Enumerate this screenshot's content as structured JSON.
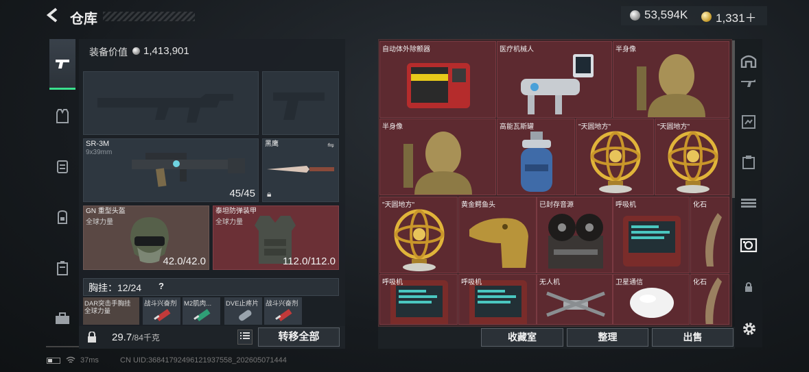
{
  "header": {
    "back_label": "<",
    "title": "仓库",
    "currency": [
      {
        "name": "silver",
        "value": "53,594K"
      },
      {
        "name": "gold",
        "value": "1,331＋"
      }
    ]
  },
  "sidebar": {
    "items": [
      {
        "name": "weapon",
        "icon": "pistol-icon",
        "glyph": "⌐"
      },
      {
        "name": "armor",
        "icon": "vest-icon",
        "glyph": "♅"
      },
      {
        "name": "tactical",
        "icon": "rig-icon",
        "glyph": "▤"
      },
      {
        "name": "backpack",
        "icon": "backpack-icon",
        "glyph": "◒"
      },
      {
        "name": "container",
        "icon": "case-icon",
        "glyph": "▥"
      },
      {
        "name": "toolbox",
        "icon": "briefcase-icon",
        "glyph": "▬"
      }
    ]
  },
  "equipment": {
    "value_label": "装备价值",
    "value": "1,413,901",
    "primary_weapon": {
      "name": "SR-3M",
      "caliber": "9x39mm",
      "ammo": "45/45"
    },
    "melee": {
      "name": "黑鹰"
    },
    "helmet": {
      "name": "GN 重型头盔",
      "sub": "全球力量",
      "durability": "42.0/42.0"
    },
    "armor": {
      "name": "泰坦防弹装甲",
      "sub": "全球力量",
      "durability": "112.0/112.0"
    },
    "chest_rig": {
      "label": "胸挂：",
      "count": "12/24",
      "help": "?"
    },
    "rig_items": [
      {
        "label": "DAR突击手胸挂",
        "sub": "全球力量"
      },
      {
        "label": "战斗兴奋剂"
      },
      {
        "label": "M2肌肉..."
      },
      {
        "label": "DVE止疼片"
      },
      {
        "label": "战斗兴奋剂"
      }
    ],
    "weight": "29.7",
    "weight_max": "/84千克",
    "transfer_all": "转移全部"
  },
  "warehouse": {
    "cells": [
      {
        "label": "自动体外除颤器",
        "art": "defib"
      },
      {
        "label": "医疗机械人",
        "art": "robot"
      },
      {
        "label": "半身像",
        "art": "bust"
      },
      {
        "label": "半身像",
        "art": "bust"
      },
      {
        "label": "高能瓦斯罐",
        "art": "gas"
      },
      {
        "label": "\"天圆地方\"",
        "art": "globe"
      },
      {
        "label": "\"天圆地方\"",
        "art": "globe"
      },
      {
        "label": "\"天圆地方\"",
        "art": "globe"
      },
      {
        "label": "黄金鳄鱼头",
        "art": "croc"
      },
      {
        "label": "已封存音源",
        "art": "tape"
      },
      {
        "label": "呼吸机",
        "art": "vent"
      },
      {
        "label": "化石",
        "art": "fossil"
      },
      {
        "label": "呼吸机",
        "art": "vent"
      },
      {
        "label": "呼吸机",
        "art": "vent"
      },
      {
        "label": "无人机",
        "art": "drone"
      },
      {
        "label": "卫星通信",
        "art": "satellite"
      },
      {
        "label": "化石",
        "art": "fossil"
      }
    ],
    "buttons": {
      "collection": "收藏室",
      "sort": "整理",
      "sell": "出售"
    }
  },
  "status_bar": {
    "ping": "37ms",
    "uid": "CN UID:36841792496121937558_202605071444"
  }
}
